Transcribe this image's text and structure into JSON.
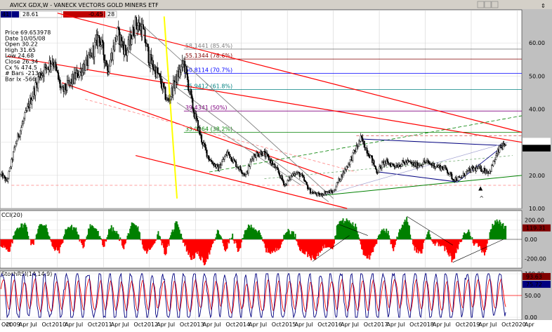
{
  "header": {
    "title": "AVICX GDX,W - VANECK VECTORS GOLD MINERS ETF",
    "field_a": "41",
    "field_b": "28.61",
    "field_c": "-0.45",
    "field_d": "28"
  },
  "info": [
    "Price 69.653978",
    "Date 10/05/08",
    "Open 30.22",
    "High 31.65",
    "Low 24.68",
    "Close 26.34",
    "Cx % 474.5",
    "# Bars -213",
    "Bar Ix -566"
  ],
  "colors": {
    "price_bg": "#ffffff",
    "panel_bg": "#ffffff",
    "channel": "#ff0000",
    "trend_gray": "#808080",
    "trend_navy": "#000080",
    "green": "#008000",
    "cci_pos": "#008000",
    "cci_neg": "#ff0000",
    "stoch_k": "#000080",
    "stoch_d": "#ff0000",
    "highlight": "#ffff00"
  },
  "chart_data": [
    {
      "type": "candlestick",
      "panel": "price",
      "ylim": [
        10,
        70
      ],
      "yticks": [
        "10.00",
        "20.00",
        "30.00",
        "40.00",
        "50.00",
        "60.00"
      ],
      "last_value_label": "28.28",
      "x_start": 2008.75,
      "x_end": 2020.1,
      "keypoints_date_value": [
        [
          2008.8,
          20
        ],
        [
          2008.9,
          18
        ],
        [
          2009.1,
          30
        ],
        [
          2009.3,
          38
        ],
        [
          2009.6,
          50
        ],
        [
          2009.9,
          55
        ],
        [
          2010.1,
          45
        ],
        [
          2010.4,
          50
        ],
        [
          2010.7,
          55
        ],
        [
          2010.9,
          62
        ],
        [
          2011.1,
          52
        ],
        [
          2011.3,
          63
        ],
        [
          2011.5,
          57
        ],
        [
          2011.7,
          66
        ],
        [
          2011.85,
          64
        ],
        [
          2012.0,
          55
        ],
        [
          2012.2,
          50
        ],
        [
          2012.4,
          42
        ],
        [
          2012.55,
          48
        ],
        [
          2012.75,
          54
        ],
        [
          2012.95,
          40
        ],
        [
          2013.15,
          30
        ],
        [
          2013.3,
          25
        ],
        [
          2013.5,
          22
        ],
        [
          2013.7,
          27
        ],
        [
          2013.9,
          23
        ],
        [
          2014.1,
          20
        ],
        [
          2014.25,
          26
        ],
        [
          2014.45,
          27
        ],
        [
          2014.6,
          25
        ],
        [
          2014.8,
          21
        ],
        [
          2014.95,
          17
        ],
        [
          2015.15,
          21
        ],
        [
          2015.3,
          20
        ],
        [
          2015.5,
          15
        ],
        [
          2015.7,
          14
        ],
        [
          2015.85,
          15
        ],
        [
          2016.0,
          15
        ],
        [
          2016.1,
          18
        ],
        [
          2016.35,
          24
        ],
        [
          2016.6,
          31
        ],
        [
          2016.8,
          26
        ],
        [
          2016.95,
          21
        ],
        [
          2017.1,
          24
        ],
        [
          2017.35,
          23
        ],
        [
          2017.6,
          24
        ],
        [
          2017.8,
          23
        ],
        [
          2018.0,
          24
        ],
        [
          2018.2,
          23
        ],
        [
          2018.45,
          22
        ],
        [
          2018.6,
          19
        ],
        [
          2018.75,
          19
        ],
        [
          2018.9,
          21
        ],
        [
          2019.05,
          22
        ],
        [
          2019.2,
          22
        ],
        [
          2019.4,
          21
        ],
        [
          2019.55,
          26
        ],
        [
          2019.65,
          29
        ],
        [
          2019.75,
          28
        ]
      ],
      "fib_levels": [
        {
          "label": "58.1441 (85.4%)",
          "value": 58.1441,
          "color": "#808080"
        },
        {
          "label": "55.1344 (78.6%)",
          "value": 55.1344,
          "color": "#800000"
        },
        {
          "label": "50.8114 (70.7%)",
          "value": 50.8114,
          "color": "#0000ff"
        },
        {
          "label": "45.9412 (61.8%)",
          "value": 45.9412,
          "color": "#008080"
        },
        {
          "label": "39.4341 (50%)",
          "value": 39.4341,
          "color": "#800080"
        },
        {
          "label": "33.0264 (38.2%)",
          "value": 33.0264,
          "color": "#008000"
        }
      ]
    },
    {
      "type": "area",
      "panel": "indicator",
      "title": "CCI(20)",
      "ylim": [
        -300,
        300
      ],
      "yticks": [
        "-200.00",
        "0.00",
        "100.00",
        "200.00"
      ],
      "last_value_label": "119.31",
      "keypoints_date_value": [
        [
          2008.8,
          -60
        ],
        [
          2008.95,
          -150
        ],
        [
          2009.1,
          120
        ],
        [
          2009.3,
          160
        ],
        [
          2009.45,
          -80
        ],
        [
          2009.6,
          140
        ],
        [
          2009.75,
          160
        ],
        [
          2009.9,
          -100
        ],
        [
          2010.05,
          -120
        ],
        [
          2010.2,
          130
        ],
        [
          2010.4,
          120
        ],
        [
          2010.55,
          -100
        ],
        [
          2010.7,
          150
        ],
        [
          2010.85,
          110
        ],
        [
          2011.0,
          -80
        ],
        [
          2011.15,
          130
        ],
        [
          2011.3,
          60
        ],
        [
          2011.45,
          -90
        ],
        [
          2011.6,
          150
        ],
        [
          2011.75,
          120
        ],
        [
          2011.9,
          -140
        ],
        [
          2012.05,
          -100
        ],
        [
          2012.2,
          80
        ],
        [
          2012.35,
          -160
        ],
        [
          2012.5,
          80
        ],
        [
          2012.6,
          200
        ],
        [
          2012.75,
          -40
        ],
        [
          2012.9,
          -200
        ],
        [
          2013.05,
          -150
        ],
        [
          2013.2,
          -250
        ],
        [
          2013.35,
          -100
        ],
        [
          2013.5,
          100
        ],
        [
          2013.65,
          -120
        ],
        [
          2013.8,
          40
        ],
        [
          2013.95,
          -140
        ],
        [
          2014.1,
          120
        ],
        [
          2014.25,
          140
        ],
        [
          2014.4,
          60
        ],
        [
          2014.55,
          -120
        ],
        [
          2014.7,
          -140
        ],
        [
          2014.85,
          -60
        ],
        [
          2015.0,
          100
        ],
        [
          2015.15,
          60
        ],
        [
          2015.3,
          -120
        ],
        [
          2015.45,
          -160
        ],
        [
          2015.6,
          -220
        ],
        [
          2015.75,
          -90
        ],
        [
          2015.9,
          -60
        ],
        [
          2016.0,
          -80
        ],
        [
          2016.1,
          180
        ],
        [
          2016.3,
          200
        ],
        [
          2016.5,
          130
        ],
        [
          2016.65,
          -140
        ],
        [
          2016.8,
          -200
        ],
        [
          2016.95,
          -30
        ],
        [
          2017.05,
          120
        ],
        [
          2017.2,
          70
        ],
        [
          2017.3,
          -120
        ],
        [
          2017.45,
          110
        ],
        [
          2017.6,
          230
        ],
        [
          2017.75,
          -90
        ],
        [
          2017.9,
          -160
        ],
        [
          2018.05,
          90
        ],
        [
          2018.2,
          -40
        ],
        [
          2018.35,
          -60
        ],
        [
          2018.5,
          -130
        ],
        [
          2018.6,
          -240
        ],
        [
          2018.72,
          -80
        ],
        [
          2018.85,
          60
        ],
        [
          2018.95,
          90
        ],
        [
          2019.05,
          -40
        ],
        [
          2019.15,
          -60
        ],
        [
          2019.3,
          -150
        ],
        [
          2019.45,
          150
        ],
        [
          2019.55,
          210
        ],
        [
          2019.65,
          160
        ],
        [
          2019.75,
          119.31
        ]
      ]
    },
    {
      "type": "line",
      "panel": "indicator",
      "title": "StochRSI(14,14,9)",
      "ylim": [
        0,
        100
      ],
      "yticks": [
        "0.00",
        "50.00",
        "100.00"
      ],
      "series": [
        {
          "last_value_label": "93.63",
          "color": "#ff0000"
        },
        {
          "last_value_label": "75.72",
          "color": "#000080"
        }
      ],
      "hline": 50
    }
  ],
  "xaxis": {
    "years": [
      "2009",
      "2010",
      "2011",
      "2012",
      "2013",
      "2014",
      "2015",
      "2016",
      "2017",
      "2018",
      "2019",
      "2020"
    ],
    "month_labels": [
      "Apr",
      "Jul",
      "Oct",
      "Jan"
    ]
  }
}
